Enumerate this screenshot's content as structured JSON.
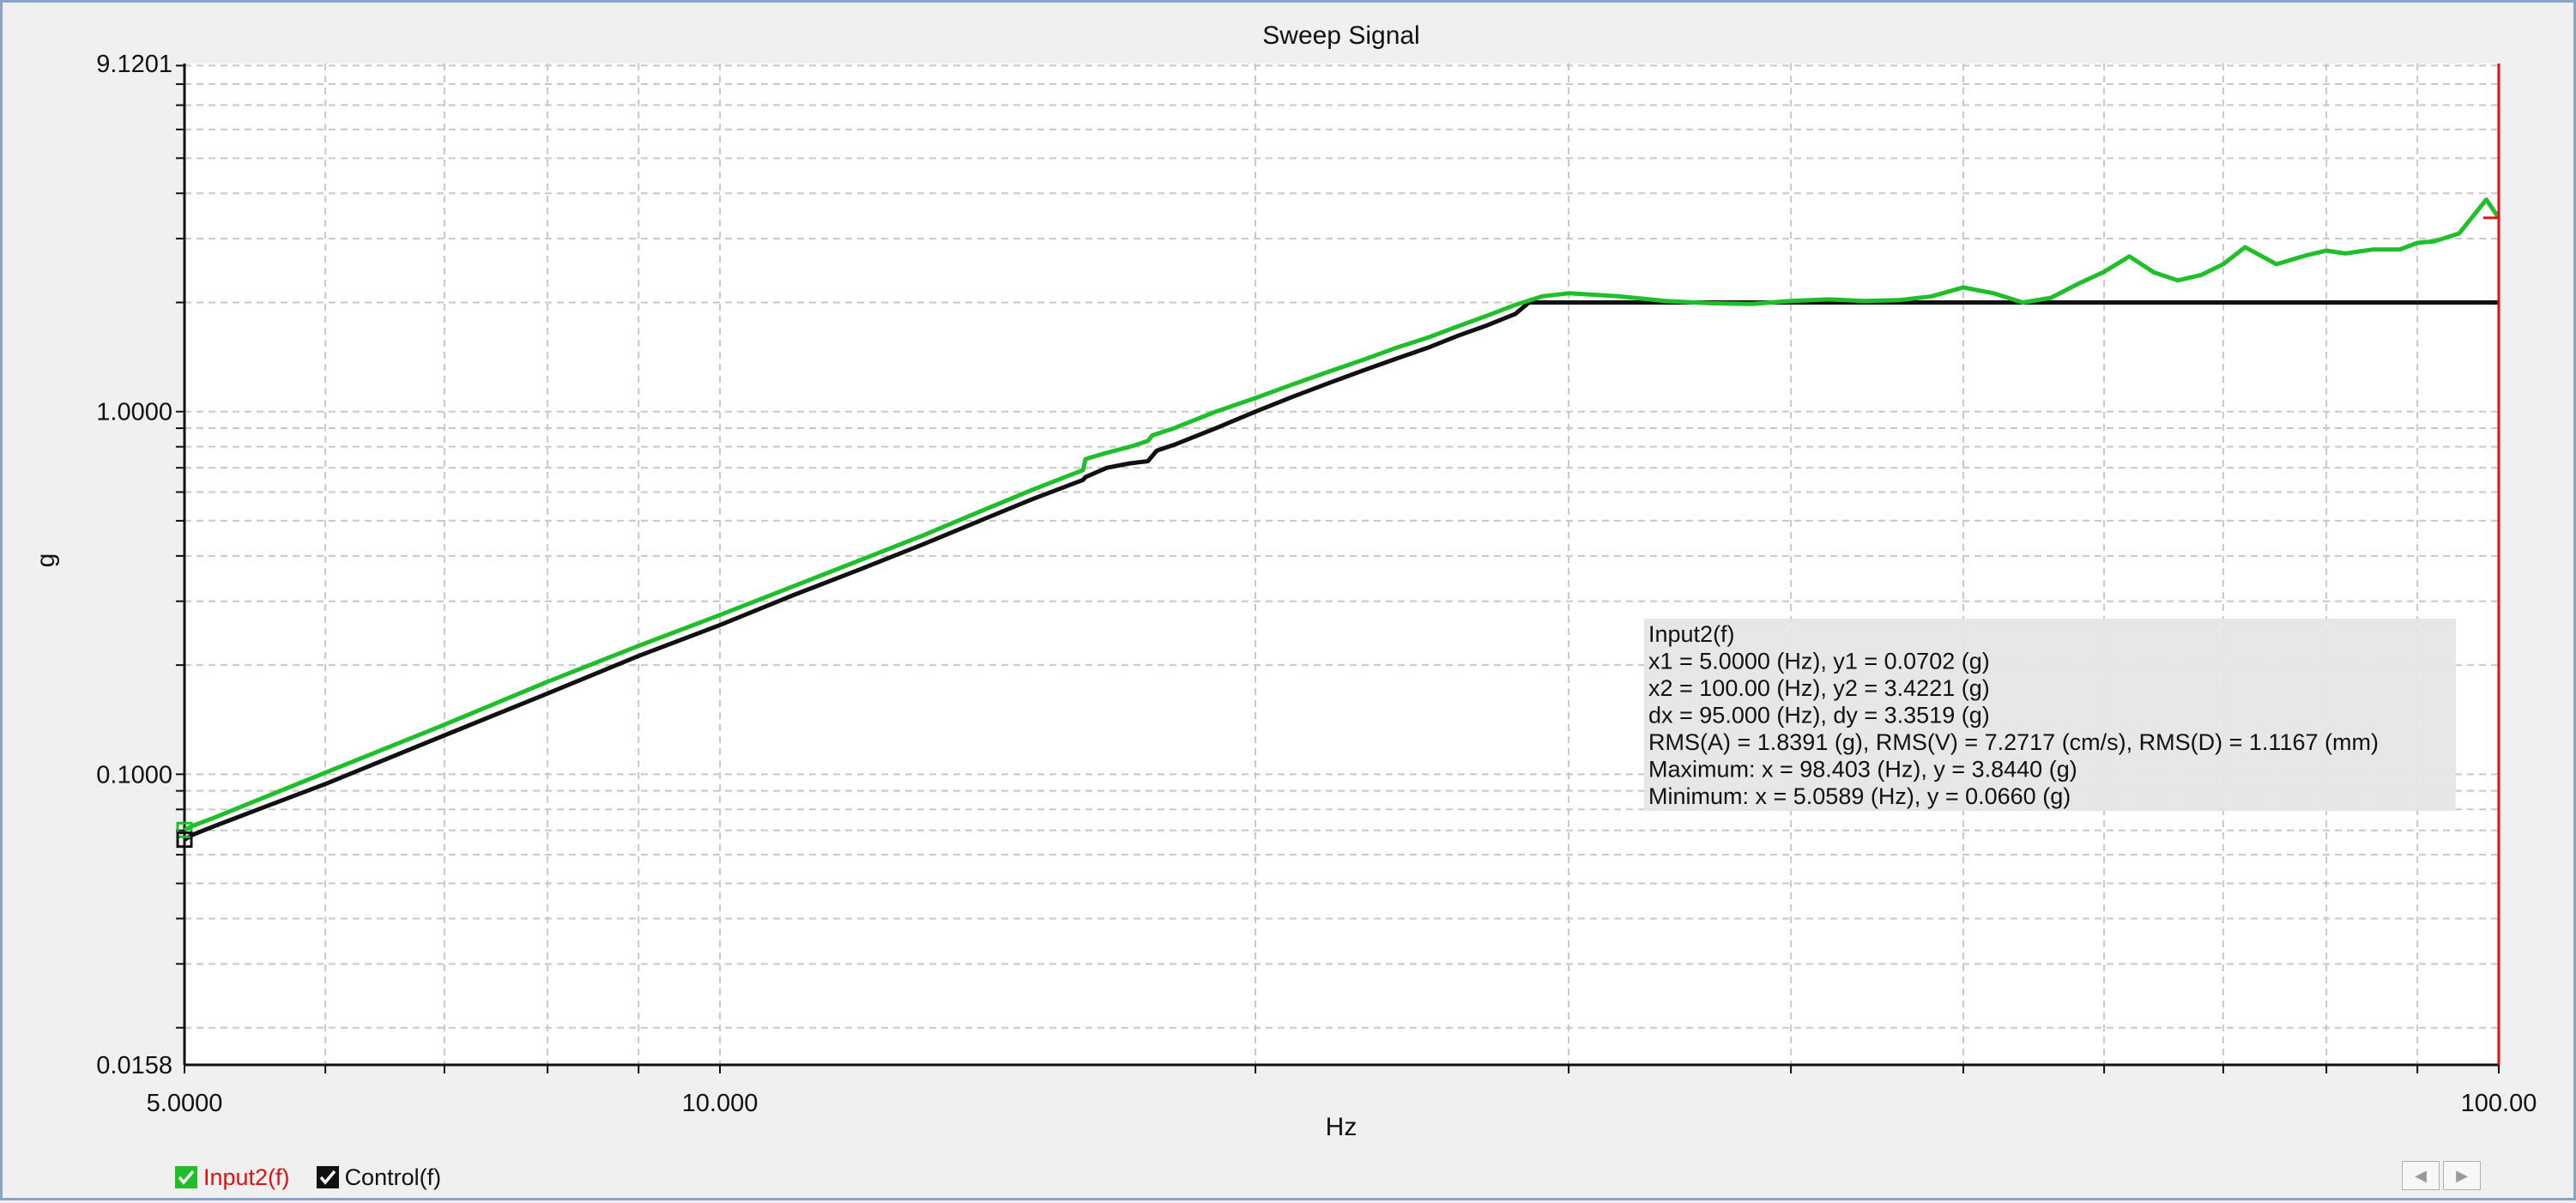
{
  "chart_data": {
    "type": "line",
    "title": "Sweep Signal",
    "xlabel": "Hz",
    "ylabel": "g",
    "xscale": "log",
    "yscale": "log",
    "xlim": [
      5.0,
      100.0
    ],
    "ylim": [
      0.0158,
      9.1201
    ],
    "x_tick_labels": [
      "5.0000",
      "10.000",
      "100.00"
    ],
    "y_tick_labels": [
      "9.1201",
      "1.0000",
      "0.1000",
      "0.0158"
    ],
    "grid": true,
    "legend_position": "bottom-left",
    "cursor_x": 100.0,
    "series": [
      {
        "name": "Input2(f)",
        "color": "#1fbf2a",
        "x": [
          5.0,
          5.05,
          5.2,
          5.5,
          6.0,
          7.0,
          8.0,
          9.0,
          10.0,
          11.0,
          12.0,
          13.0,
          14.0,
          15.0,
          16.0,
          16.05,
          16.5,
          17.0,
          17.4,
          17.5,
          18.0,
          19.0,
          20.0,
          21.0,
          22.0,
          23.0,
          24.0,
          25.0,
          26.0,
          27.0,
          28.0,
          29.0,
          30.0,
          32.0,
          34.0,
          36.0,
          38.0,
          40.0,
          42.0,
          44.0,
          46.0,
          48.0,
          50.0,
          52.0,
          54.0,
          56.0,
          58.0,
          60.0,
          62.0,
          64.0,
          66.0,
          68.0,
          70.0,
          72.0,
          75.0,
          78.0,
          80.0,
          82.0,
          85.0,
          88.0,
          90.0,
          92.0,
          95.0,
          98.4,
          100.0
        ],
        "y": [
          0.0702,
          0.072,
          0.076,
          0.085,
          0.101,
          0.137,
          0.18,
          0.226,
          0.275,
          0.33,
          0.39,
          0.455,
          0.53,
          0.61,
          0.69,
          0.74,
          0.77,
          0.8,
          0.83,
          0.86,
          0.9,
          1.0,
          1.09,
          1.19,
          1.29,
          1.39,
          1.5,
          1.6,
          1.72,
          1.84,
          1.97,
          2.08,
          2.12,
          2.08,
          2.02,
          1.99,
          1.98,
          2.02,
          2.04,
          2.02,
          2.03,
          2.08,
          2.2,
          2.12,
          2.0,
          2.06,
          2.25,
          2.43,
          2.68,
          2.42,
          2.3,
          2.38,
          2.55,
          2.84,
          2.55,
          2.7,
          2.78,
          2.73,
          2.8,
          2.8,
          2.92,
          2.95,
          3.1,
          3.844,
          3.4221
        ]
      },
      {
        "name": "Control(f)",
        "color": "#111111",
        "x": [
          5.0,
          5.05,
          5.2,
          5.5,
          6.0,
          7.0,
          8.0,
          9.0,
          10.0,
          11.0,
          12.0,
          13.0,
          14.0,
          15.0,
          16.0,
          16.05,
          16.5,
          17.0,
          17.4,
          17.6,
          18.0,
          19.0,
          20.0,
          21.0,
          22.0,
          23.0,
          24.0,
          25.0,
          26.0,
          27.0,
          28.0,
          28.5,
          30.0,
          40.0,
          50.0,
          60.0,
          70.0,
          80.0,
          90.0,
          100.0
        ],
        "y": [
          0.066,
          0.068,
          0.072,
          0.08,
          0.094,
          0.128,
          0.167,
          0.212,
          0.258,
          0.312,
          0.368,
          0.43,
          0.5,
          0.575,
          0.648,
          0.66,
          0.7,
          0.72,
          0.73,
          0.78,
          0.81,
          0.9,
          1.0,
          1.1,
          1.2,
          1.3,
          1.4,
          1.5,
          1.62,
          1.73,
          1.86,
          2.0,
          2.0,
          2.0,
          2.0,
          2.0,
          2.0,
          2.0,
          2.0,
          2.0
        ]
      }
    ]
  },
  "info_box": {
    "lines": [
      "Input2(f)",
      "x1 = 5.0000 (Hz), y1 = 0.0702 (g)",
      "x2 = 100.00 (Hz), y2 = 3.4221 (g)",
      "dx = 95.000 (Hz), dy = 3.3519 (g)",
      "RMS(A) = 1.8391 (g), RMS(V) = 7.2717 (cm/s), RMS(D) = 1.1167 (mm)",
      "Maximum: x = 98.403 (Hz), y = 3.8440 (g)",
      "Minimum: x = 5.0589 (Hz), y = 0.0660 (g)"
    ]
  },
  "legend": {
    "items": [
      {
        "label": "Input2(f)",
        "text_color": "#e01010",
        "box_color": "#1fbf2a"
      },
      {
        "label": "Control(f)",
        "text_color": "#111111",
        "box_color": "#111111"
      }
    ]
  },
  "nav": {
    "prev_icon": "◀",
    "next_icon": "▶"
  }
}
